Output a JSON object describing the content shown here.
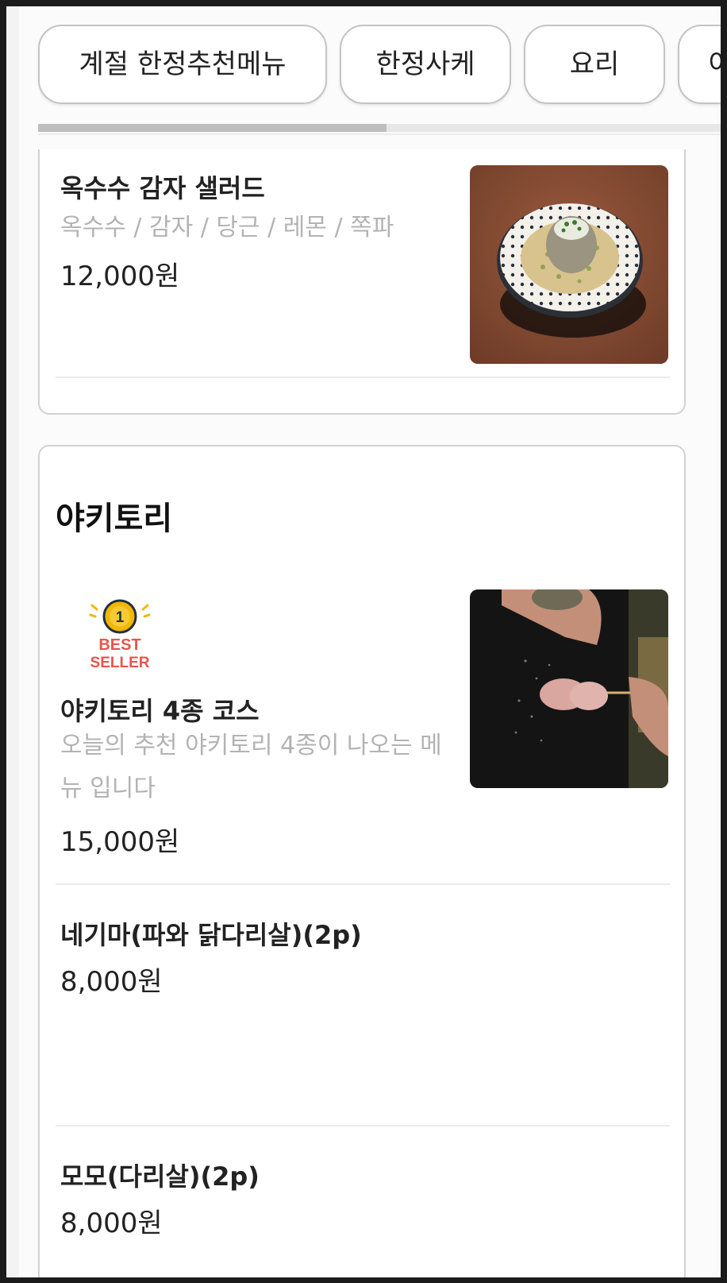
{
  "tabs": [
    "계절 한정추천메뉴",
    "한정사케",
    "요리",
    "이"
  ],
  "tab_scroll": {
    "visible_fraction": 0.51
  },
  "menu": {
    "salad": {
      "name": "옥수수 감자 샐러드",
      "desc": "옥수수 / 감자 / 당근 / 레몬 / 쪽파",
      "price": "12,000원",
      "image": "potato-salad-photo"
    },
    "yakitori": {
      "title": "야키토리",
      "items": [
        {
          "badge_number": "1",
          "badge_line1": "BEST",
          "badge_line2": "SELLER",
          "name": "야키토리 4종 코스",
          "desc": "오늘의 추천 야키토리 4종이 나오는 메뉴 입니다",
          "price": "15,000원",
          "image": "yakitori-skewer-photo"
        },
        {
          "name": "네기마(파와 닭다리살)(2p)",
          "price": "8,000원"
        },
        {
          "name": "모모(다리살)(2p)",
          "price": "8,000원"
        }
      ]
    }
  },
  "colors": {
    "badge_gold": "#f2b705",
    "badge_red": "#e8554b",
    "desc_gray": "#b3b3b3"
  }
}
